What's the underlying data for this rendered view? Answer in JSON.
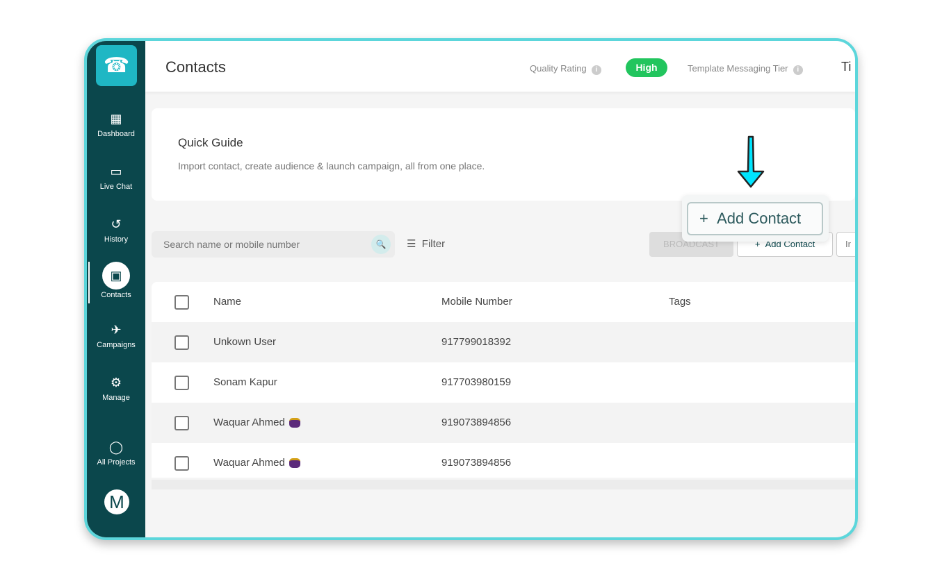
{
  "sidebar": {
    "items": [
      {
        "label": "Dashboard",
        "icon": "dashboard-icon"
      },
      {
        "label": "Live Chat",
        "icon": "chat-icon"
      },
      {
        "label": "History",
        "icon": "history-icon"
      },
      {
        "label": "Contacts",
        "icon": "contacts-icon",
        "active": true
      },
      {
        "label": "Campaigns",
        "icon": "plane-icon"
      },
      {
        "label": "Manage",
        "icon": "gear-icon"
      },
      {
        "label": "All Projects",
        "icon": "projects-icon"
      }
    ],
    "avatar": "M"
  },
  "header": {
    "title": "Contacts",
    "quality_label": "Quality Rating",
    "quality_value": "High",
    "quality_color": "#22c55e",
    "tier_label": "Template Messaging Tier",
    "tier_value": "Ti"
  },
  "guide": {
    "title": "Quick Guide",
    "text": "Import contact, create audience & launch campaign, all from one place."
  },
  "toolbar": {
    "search_placeholder": "Search name or mobile number",
    "filter": "Filter",
    "broadcast": "BROADCAST",
    "add_contact": "Add Contact",
    "import": "Ir"
  },
  "highlight": {
    "add_contact": "Add Contact",
    "arrow_color": "#00e5ff"
  },
  "table": {
    "headers": [
      "Name",
      "Mobile Number",
      "Tags"
    ],
    "rows": [
      {
        "name": "Unkown User",
        "mobile": "917799018392"
      },
      {
        "name": "Sonam Kapur",
        "mobile": "917703980159"
      },
      {
        "name": "Waquar Ahmed",
        "mobile": "919073894856",
        "badge": true
      },
      {
        "name": "Waquar Ahmed",
        "mobile": "919073894856",
        "badge": true
      }
    ]
  }
}
